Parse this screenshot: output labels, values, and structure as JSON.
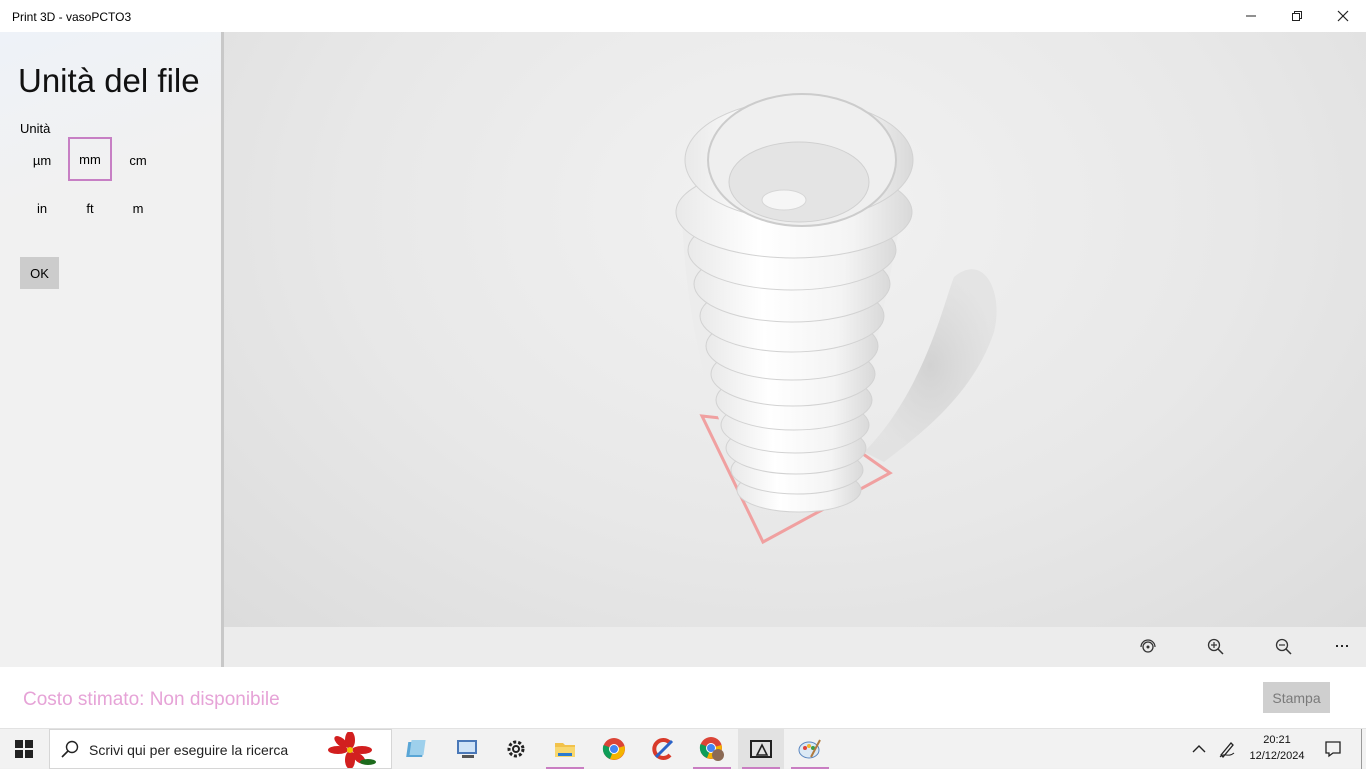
{
  "window": {
    "title": "Print 3D - vasoPCTO3",
    "controls": {
      "minimize": "minimize-icon",
      "restore": "restore-icon",
      "close": "close-icon"
    }
  },
  "panel": {
    "title": "Unità del file",
    "unit_label": "Unità",
    "units": [
      "µm",
      "mm",
      "cm",
      "in",
      "ft",
      "m"
    ],
    "selected_unit": "mm",
    "ok_label": "OK"
  },
  "viewport": {
    "toolbar": [
      "view-reset-icon",
      "zoom-in-icon",
      "zoom-out-icon"
    ],
    "more_label": "..."
  },
  "footer": {
    "cost_text": "Costo stimato: Non disponibile",
    "print_label": "Stampa"
  },
  "taskbar": {
    "search_placeholder": "Scrivi qui per eseguire la ricerca",
    "apps": [
      "start",
      "onedrive",
      "control-panel",
      "settings",
      "file-explorer",
      "chrome",
      "ccleaner",
      "chrome-profile",
      "print-3d",
      "paint-3d"
    ],
    "time": "20:21",
    "date": "12/12/2024"
  },
  "colors": {
    "accent": "#c77fc4",
    "cost_text": "#e6a3d7",
    "plate_outline": "#f0a0a0"
  }
}
